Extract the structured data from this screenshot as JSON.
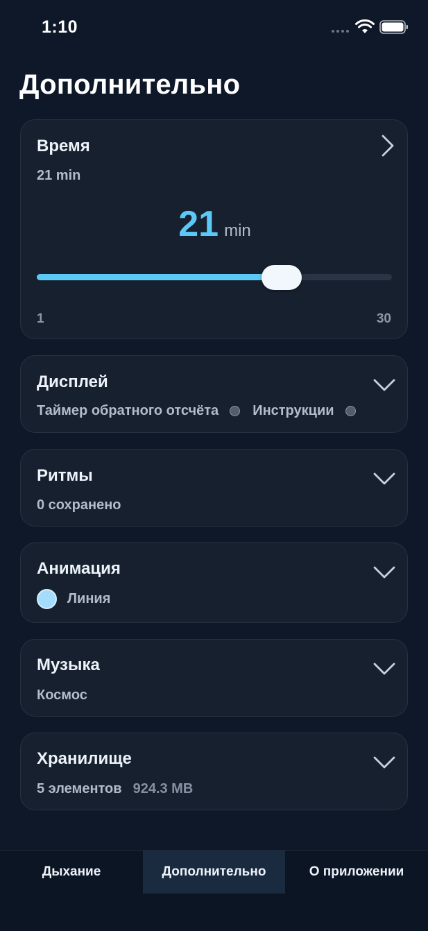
{
  "status_bar": {
    "time": "1:10"
  },
  "page": {
    "title": "Дополнительно"
  },
  "time_card": {
    "title": "Время",
    "subtitle": "21 min",
    "value": "21",
    "unit": "min",
    "slider": {
      "min": 1,
      "max": 30,
      "value": 21,
      "min_label": "1",
      "max_label": "30"
    }
  },
  "display_card": {
    "title": "Дисплей",
    "options": [
      {
        "label": "Таймер обратного отсчёта"
      },
      {
        "label": "Инструкции"
      }
    ]
  },
  "rhythms_card": {
    "title": "Ритмы",
    "subtitle": "0 сохранено"
  },
  "animation_card": {
    "title": "Анимация",
    "selected": "Линия"
  },
  "music_card": {
    "title": "Музыка",
    "subtitle": "Космос"
  },
  "storage_card": {
    "title": "Хранилище",
    "items": "5 элементов",
    "size": "924.3 MB"
  },
  "tabs": [
    {
      "label": "Дыхание"
    },
    {
      "label": "Дополнительно"
    },
    {
      "label": "О приложении"
    }
  ],
  "colors": {
    "accent": "#5bc8f5",
    "background": "#0e1828",
    "card": "#17202f"
  }
}
